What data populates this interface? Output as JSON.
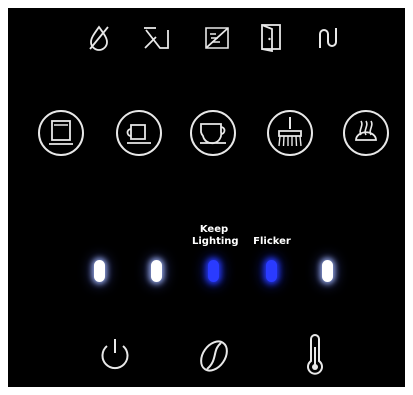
{
  "status_icons": [
    "descale-icon",
    "filter-icon",
    "no-filter-icon",
    "door-open-icon",
    "steam-icon"
  ],
  "function_buttons": [
    "hot-water-icon",
    "espresso-icon",
    "coffee-cup-icon",
    "cleaning-brush-icon",
    "milk-froth-icon"
  ],
  "leds": [
    {
      "color": "white",
      "state": "on"
    },
    {
      "color": "white",
      "state": "on"
    },
    {
      "color": "blue",
      "state": "on"
    },
    {
      "color": "blue",
      "state": "on"
    },
    {
      "color": "white",
      "state": "on"
    }
  ],
  "labels": {
    "keep_line1": "Keep",
    "keep_line2": "Lighting",
    "flicker": "Flicker"
  },
  "bottom_buttons": [
    "power-icon",
    "coffee-bean-icon",
    "thermometer-icon"
  ],
  "colors": {
    "panel": "#000000",
    "icon_stroke": "#e8e8e8",
    "led_white": "#ffffff",
    "led_blue": "#2a3bff"
  }
}
